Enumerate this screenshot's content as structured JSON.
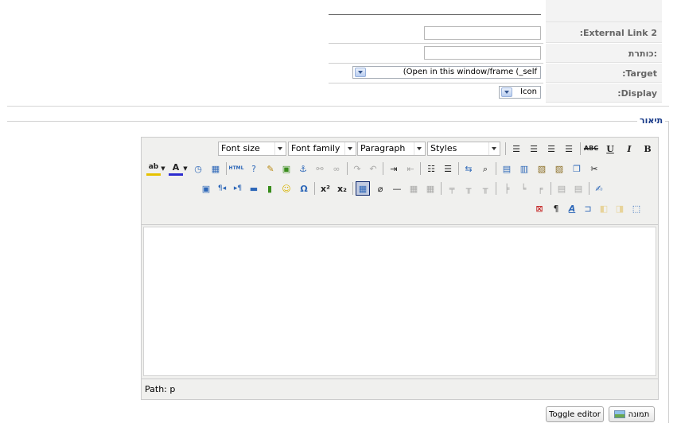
{
  "form": {
    "rows": [
      {
        "label": ":External Link 2",
        "type": "text"
      },
      {
        "label": "כותרת:",
        "type": "text"
      },
      {
        "label": ":Target",
        "type": "select",
        "value": "(Open in this window/frame (_self"
      },
      {
        "label": ":Display",
        "type": "select",
        "value": "Icon"
      }
    ]
  },
  "fieldset": {
    "legend": "תיאור"
  },
  "editor": {
    "selects": {
      "font_size": "Font size",
      "font_family": "Font family",
      "paragraph": "Paragraph",
      "styles": "Styles"
    },
    "path_label": "Path: p"
  },
  "buttons": {
    "image": "תמונה",
    "toggle": "Toggle editor"
  },
  "colors": {
    "label_bg": "#f3f3f3",
    "legend": "#1a3c8a",
    "editor_bg": "#f0f0ee"
  }
}
